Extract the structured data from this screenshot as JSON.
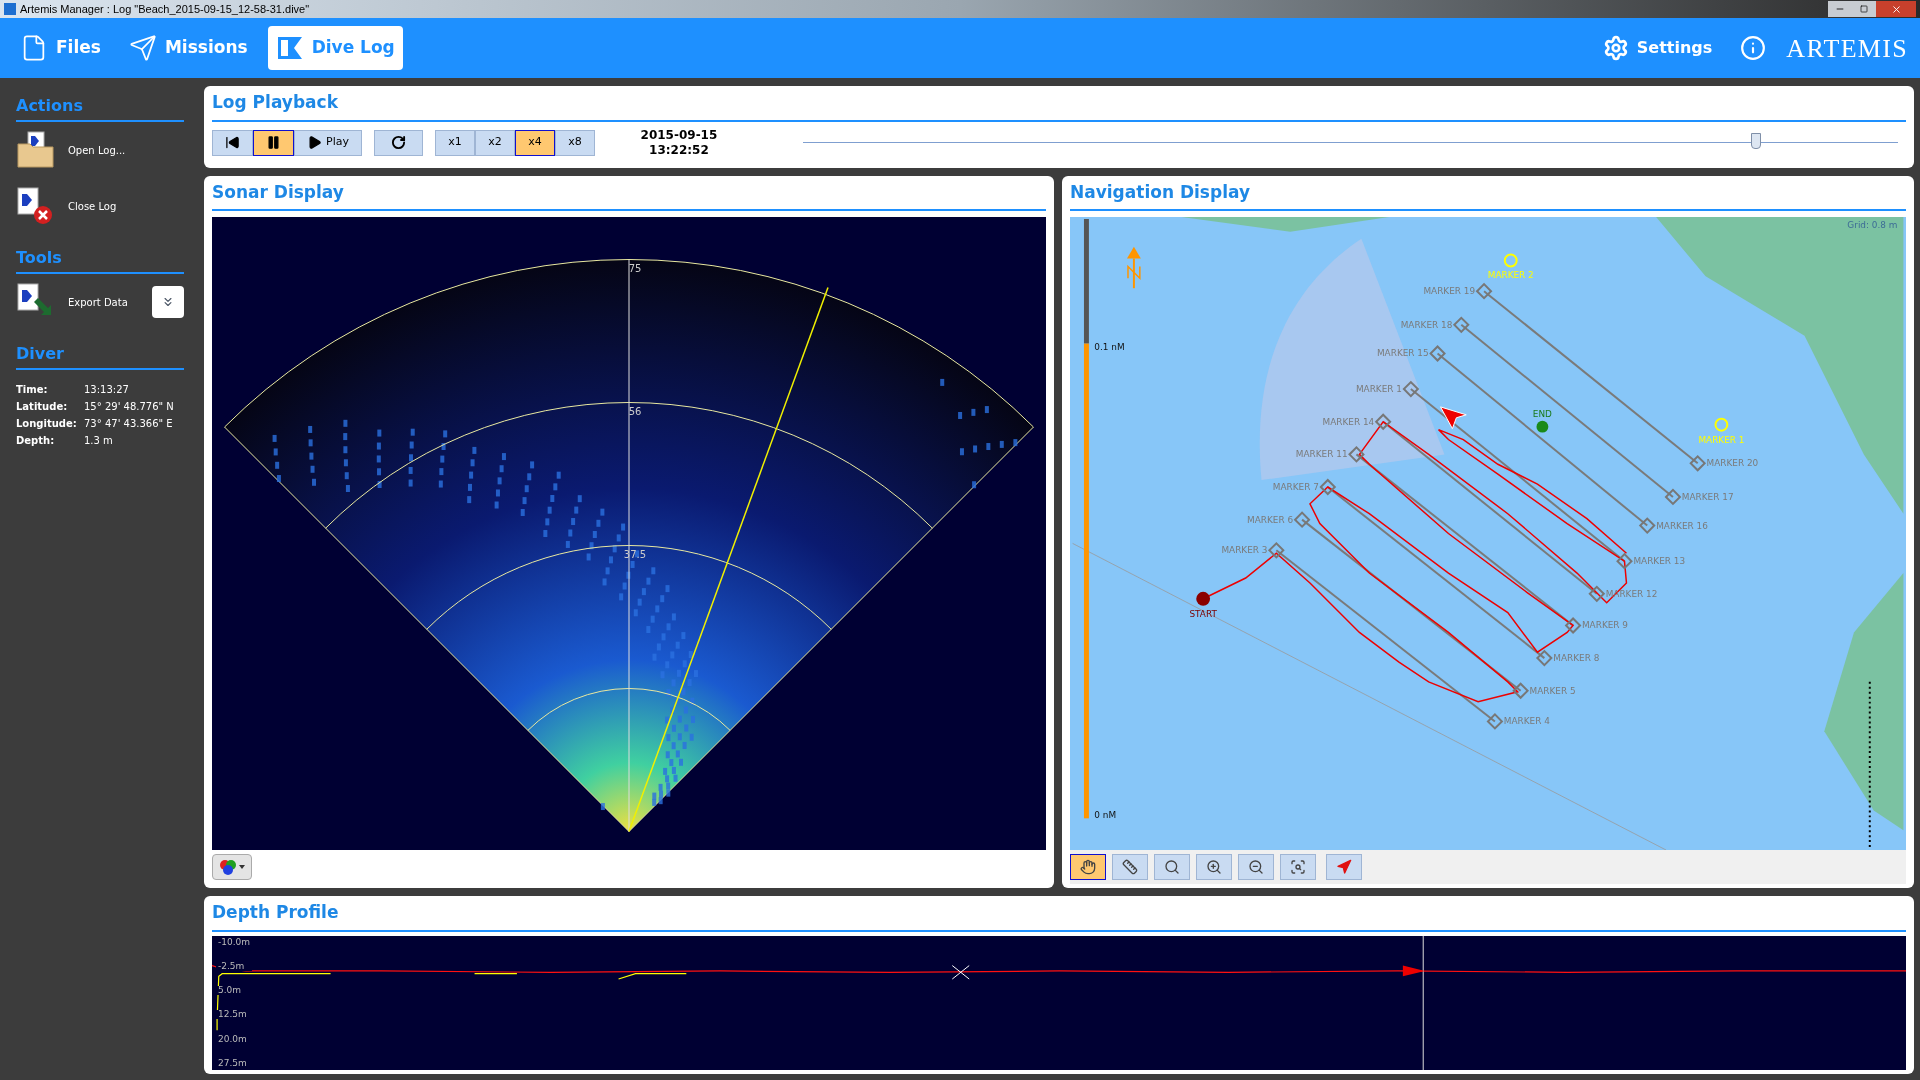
{
  "window": {
    "title": "Artemis Manager : Log \"Beach_2015-09-15_12-58-31.dive\""
  },
  "nav_tabs": [
    {
      "label": "Files",
      "selected": false
    },
    {
      "label": "Missions",
      "selected": false
    },
    {
      "label": "Dive Log",
      "selected": true
    }
  ],
  "settings": {
    "label": "Settings"
  },
  "logo": "ARTEMIS",
  "sidebar": {
    "sections": [
      {
        "title": "Actions",
        "items": [
          {
            "label": "Open Log..."
          },
          {
            "label": "Close Log"
          }
        ]
      },
      {
        "title": "Tools",
        "items": [
          {
            "label": "Export Data",
            "dropdown": true
          }
        ]
      }
    ],
    "diver": {
      "title": "Diver",
      "rows": [
        {
          "label": "Time:",
          "value": "13:13:27"
        },
        {
          "label": "Latitude:",
          "value": "15° 29' 48.776\" N"
        },
        {
          "label": "Longitude:",
          "value": "73° 47' 43.366\" E"
        },
        {
          "label": "Depth:",
          "value": "1.3 m"
        }
      ]
    }
  },
  "playback": {
    "title": "Log Playback",
    "transport": [
      {
        "kind": "rewind",
        "selected": false
      },
      {
        "kind": "pause",
        "selected": true
      },
      {
        "kind": "play",
        "label": "Play",
        "selected": false
      }
    ],
    "speeds": [
      {
        "label": "x1",
        "selected": false
      },
      {
        "label": "x2",
        "selected": false
      },
      {
        "label": "x4",
        "selected": true
      },
      {
        "label": "x8",
        "selected": false
      }
    ],
    "date": "2015-09-15",
    "time": "13:22:52",
    "level": 0.87
  },
  "sonar": {
    "title": "Sonar Display",
    "range_labels": [
      "75",
      "56",
      "37.5"
    ]
  },
  "navigation": {
    "title": "Navigation Display",
    "grid_label": "Grid: 0.8 m",
    "scale_labels": [
      "0.1 nM",
      "0 nM"
    ],
    "waypoints": [
      {
        "kind": "target",
        "label": "MARKER 2"
      },
      {
        "kind": "diamond",
        "label": "MARKER 19"
      },
      {
        "kind": "diamond",
        "label": "MARKER 18"
      },
      {
        "kind": "diamond",
        "label": "MARKER 15"
      },
      {
        "kind": "diamond",
        "label": "MARKER 1"
      },
      {
        "kind": "diamond",
        "label": "MARKER 14"
      },
      {
        "kind": "diamond",
        "label": "MARKER 11"
      },
      {
        "kind": "diamond",
        "label": "MARKER 7"
      },
      {
        "kind": "diamond",
        "label": "MARKER 6"
      },
      {
        "kind": "diamond",
        "label": "MARKER 3"
      },
      {
        "kind": "start",
        "label": "START"
      },
      {
        "kind": "diamond",
        "label": "MARKER 4"
      },
      {
        "kind": "diamond",
        "label": "MARKER 5"
      },
      {
        "kind": "diamond",
        "label": "MARKER 8"
      },
      {
        "kind": "diamond",
        "label": "MARKER 9"
      },
      {
        "kind": "diamond",
        "label": "MARKER 12"
      },
      {
        "kind": "diamond",
        "label": "MARKER 13"
      },
      {
        "kind": "diamond",
        "label": "MARKER 16"
      },
      {
        "kind": "diamond",
        "label": "MARKER 17"
      },
      {
        "kind": "diamond",
        "label": "MARKER 20"
      },
      {
        "kind": "end",
        "label": "END"
      },
      {
        "kind": "target",
        "label": "MARKER 1"
      }
    ],
    "tools": [
      {
        "selected": true
      },
      {
        "selected": false
      },
      {
        "selected": false
      },
      {
        "selected": false
      },
      {
        "selected": false
      },
      {
        "selected": false
      },
      {
        "selected": false
      }
    ]
  },
  "depth_profile": {
    "title": "Depth Profile",
    "axis_labels": [
      "-10.0m",
      "-2.5m",
      "5.0m",
      "12.5m",
      "20.0m",
      "27.5m"
    ]
  }
}
